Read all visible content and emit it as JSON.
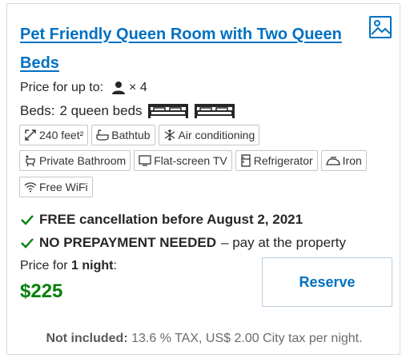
{
  "room": {
    "title": "Pet Friendly Queen Room with Two Queen Beds",
    "price_for_up_to_label": "Price for up to:",
    "occupancy": "× 4",
    "beds_label": "Beds:",
    "beds_value": "2 queen beds"
  },
  "facilities": {
    "row1": [
      {
        "label": "240 feet²",
        "icon": "room-size-icon"
      },
      {
        "label": "Bathtub",
        "icon": "bathtub-icon"
      },
      {
        "label": "Air conditioning",
        "icon": "snowflake-icon"
      }
    ],
    "row2": [
      {
        "label": "Private Bathroom",
        "icon": "private-bathroom-icon"
      },
      {
        "label": "Flat-screen TV",
        "icon": "tv-icon"
      },
      {
        "label": "Refrigerator",
        "icon": "refrigerator-icon"
      },
      {
        "label": "Iron",
        "icon": "iron-icon"
      }
    ],
    "row3": [
      {
        "label": "Free WiFi",
        "icon": "wifi-icon"
      }
    ]
  },
  "policies": {
    "cancellation": "FREE cancellation before August 2, 2021",
    "prepayment": "NO PREPAYMENT NEEDED",
    "prepayment_suffix": "– pay at the property"
  },
  "pricing": {
    "price_for_label": "Price for",
    "nights": "1 night",
    "colon": ":",
    "price": "$225",
    "reserve_label": "Reserve",
    "not_included_label": "Not included:",
    "not_included_text": "13.6 % TAX, US$ 2.00 City tax per night."
  },
  "colors": {
    "link": "#0071c2",
    "price": "#008009",
    "check": "#008009"
  }
}
